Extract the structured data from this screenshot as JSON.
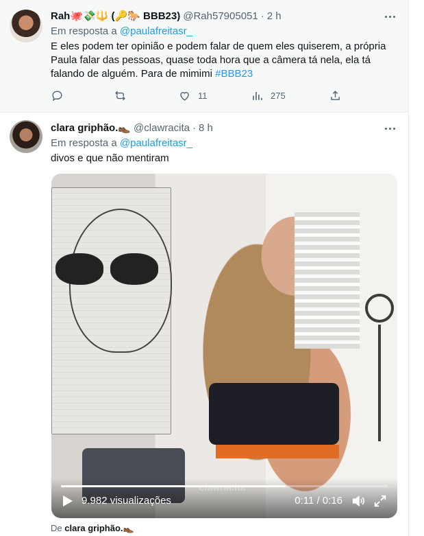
{
  "tweets": [
    {
      "display_name": "Rah🐙💸🔱 (🔑🐎 BBB23)",
      "handle": "@Rah57905051",
      "dot": "·",
      "time": "2 h",
      "reply_prefix": "Em resposta a",
      "reply_mention": "@paulafreitasr_",
      "text": "E eles podem ter opinião e podem falar de quem eles quiserem, a própria Paula falar das pessoas, quase toda hora que a câmera tá nela, ela tá falando de alguém. Para de mimimi",
      "hashtag": "#BBB23",
      "stats": {
        "reply": "",
        "retweet": "",
        "like": "11",
        "views": "275"
      }
    },
    {
      "display_name": "clara griphão.👞",
      "handle": "@clawracita",
      "dot": "·",
      "time": "8 h",
      "reply_prefix": "Em resposta a",
      "reply_mention": "@paulafreitasr_",
      "text": "divos e que não mentiram",
      "video": {
        "watermark": "clawracita",
        "views": "9.982 visualizações",
        "time": "0:11 / 0:16",
        "progress": 0.6875
      },
      "attribution_prefix": "De",
      "attribution_name": "clara griphão.👞"
    }
  ],
  "colors": {
    "accent": "#1d9bf0",
    "muted": "#536471",
    "text": "#0f1419"
  },
  "icons": [
    "more-icon",
    "reply-icon",
    "retweet-icon",
    "like-icon",
    "views-icon",
    "share-icon",
    "play-icon",
    "volume-icon",
    "fullscreen-icon"
  ]
}
